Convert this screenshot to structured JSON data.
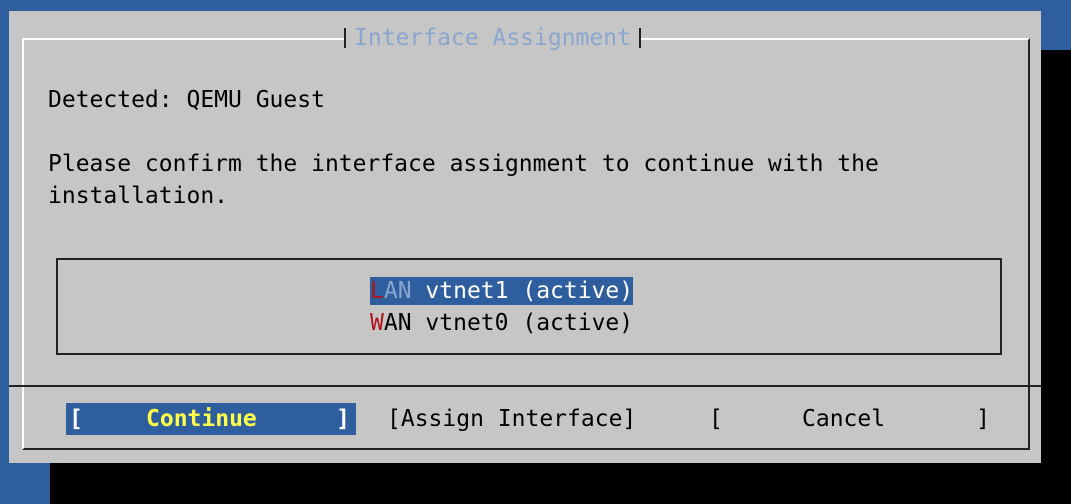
{
  "dialog": {
    "title": "Interface Assignment",
    "detected_line": "Detected: QEMU Guest",
    "message_line1": "Please confirm the interface assignment to continue with the",
    "message_line2": "installation."
  },
  "interfaces": [
    {
      "tag_first": "L",
      "tag_rest": "AN",
      "description": "vtnet1 (active)",
      "selected": true
    },
    {
      "tag_first": "W",
      "tag_rest": "AN",
      "description": "vtnet0 (active)",
      "selected": false
    }
  ],
  "buttons": {
    "continue": {
      "open": "[",
      "label": "Continue",
      "close": "]"
    },
    "assign": {
      "open": "[",
      "label": "Assign Interface",
      "close": "]"
    },
    "cancel": {
      "open": "[",
      "label": "Cancel",
      "close": "]"
    }
  },
  "colors": {
    "background": "#2f5e9e",
    "dialog": "#c6c6c6",
    "title": "#8aa6cf",
    "hotkey": "#b0141e",
    "focused_label": "#ffff4a"
  }
}
